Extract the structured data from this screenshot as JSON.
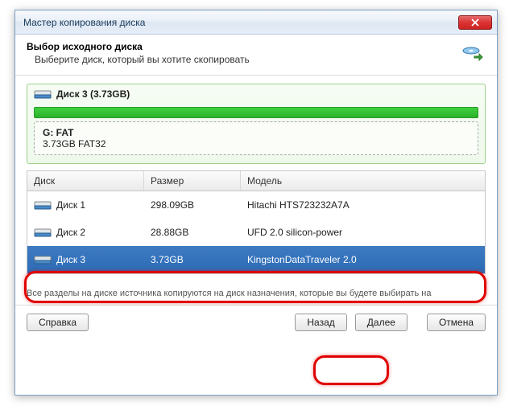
{
  "window": {
    "title": "Мастер копирования диска"
  },
  "header": {
    "title": "Выбор исходного диска",
    "subtitle": "Выберите диск, который вы хотите скопировать"
  },
  "disk_panel": {
    "title": "Диск 3 (3.73GB)",
    "partition_name": "G: FAT",
    "partition_detail": "3.73GB FAT32"
  },
  "table": {
    "headers": {
      "disk": "Диск",
      "size": "Размер",
      "model": "Модель"
    },
    "rows": [
      {
        "disk": "Диск 1",
        "size": "298.09GB",
        "model": "Hitachi HTS723232A7A",
        "selected": false
      },
      {
        "disk": "Диск 2",
        "size": "28.88GB",
        "model": "UFD 2.0 silicon-power",
        "selected": false
      },
      {
        "disk": "Диск 3",
        "size": "3.73GB",
        "model": "KingstonDataTraveler 2.0",
        "selected": true
      }
    ]
  },
  "footer_text": "Все разделы на диске источника копируются на диск назначения, которые вы будете выбирать на",
  "buttons": {
    "help": "Справка",
    "back": "Назад",
    "next": "Далее",
    "cancel": "Отмена"
  }
}
